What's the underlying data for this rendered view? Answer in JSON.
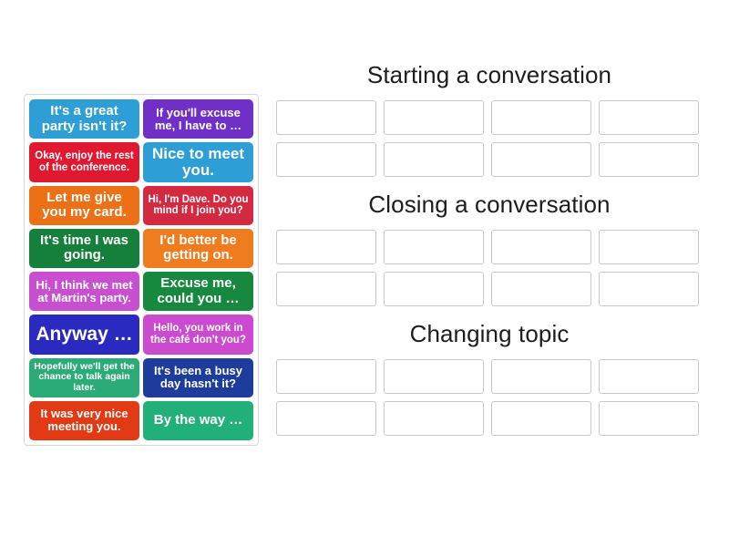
{
  "tiles": [
    {
      "text": "It's a great party isn't it?",
      "color": "#2e9ed6",
      "size": "fs-lg"
    },
    {
      "text": "If you'll excuse me, I have to …",
      "color": "#7030c8",
      "size": "fs-md"
    },
    {
      "text": "Okay, enjoy the rest of the conference.",
      "color": "#e01931",
      "size": "fs-sm"
    },
    {
      "text": "Nice to meet you.",
      "color": "#2e9ed6",
      "size": "fs-xl"
    },
    {
      "text": "Let me give you my card.",
      "color": "#ec7015",
      "size": "fs-lg"
    },
    {
      "text": "Hi, I'm Dave. Do you mind if I join you?",
      "color": "#d42a41",
      "size": "fs-sm"
    },
    {
      "text": "It's time I was going.",
      "color": "#157f3c",
      "size": "fs-lg"
    },
    {
      "text": "I'd better be getting on.",
      "color": "#ef7c1f",
      "size": "fs-lg"
    },
    {
      "text": "Hi, I think we met at Martin's party.",
      "color": "#c74fd0",
      "size": "fs-md"
    },
    {
      "text": "Excuse me, could you …",
      "color": "#17893f",
      "size": "fs-lg"
    },
    {
      "text": "Anyway …",
      "color": "#2a2ac0",
      "size": "fs-huge"
    },
    {
      "text": "Hello, you work in the café don't you?",
      "color": "#cc4ad0",
      "size": "fs-sm"
    },
    {
      "text": "Hopefully we'll get the chance to talk again later.",
      "color": "#2bab77",
      "size": "fs-xs"
    },
    {
      "text": "It's been a busy day hasn't it?",
      "color": "#1d3c9c",
      "size": "fs-md"
    },
    {
      "text": "It was very nice meeting you.",
      "color": "#e23a15",
      "size": "fs-md"
    },
    {
      "text": "By the way …",
      "color": "#22b07a",
      "size": "fs-lg"
    }
  ],
  "groups": [
    {
      "title": "Starting a conversation",
      "slot_count": 8
    },
    {
      "title": "Closing a conversation",
      "slot_count": 8
    },
    {
      "title": "Changing topic",
      "slot_count": 8
    }
  ]
}
